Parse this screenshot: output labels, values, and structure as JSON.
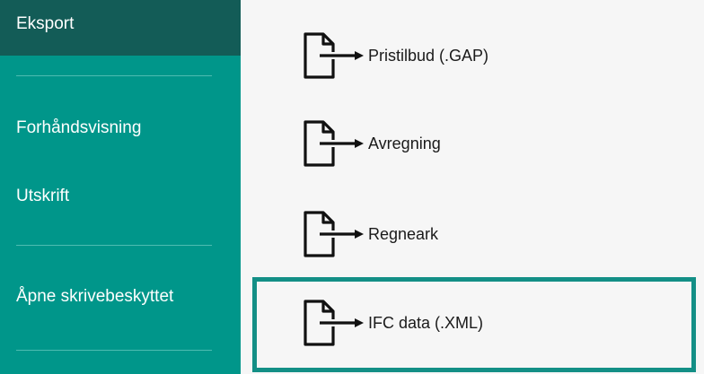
{
  "sidebar": {
    "items": [
      {
        "label": "Eksport",
        "selected": true
      },
      {
        "label": "Forhåndsvisning",
        "selected": false
      },
      {
        "label": "Utskrift",
        "selected": false
      },
      {
        "label": "Åpne skrivebeskyttet",
        "selected": false
      }
    ],
    "colors": {
      "background": "#00968a",
      "selected_background": "#135c57",
      "text": "#ffffff"
    }
  },
  "export_options": [
    {
      "label": "Pristilbud (.GAP)",
      "icon": "export-document-icon"
    },
    {
      "label": "Avregning",
      "icon": "export-document-icon"
    },
    {
      "label": "Regneark",
      "icon": "export-document-icon"
    },
    {
      "label": "IFC data (.XML)",
      "icon": "export-document-icon",
      "highlighted": true
    }
  ],
  "colors": {
    "highlight_border": "#138f86",
    "content_background": "#f6f6f6"
  }
}
